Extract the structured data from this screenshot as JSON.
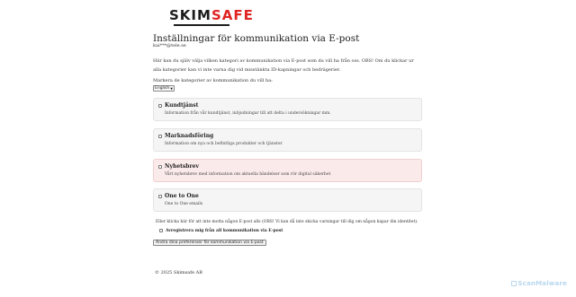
{
  "logo": {
    "part1": "SKIM",
    "part2": "SAFE"
  },
  "page": {
    "title": "Inställningar för kommunikation via E-post",
    "email": "kai***@tele.se",
    "intro": "Här kan du själv välja vilken kategori av kommunikation via E-post som du vill ha från oss. OBS! Om du klickar ur alla kategorier kan vi inte varna dig vid misstänkta ID-kapningar och bedrägerier.",
    "pick_label": "Markera de kategorier av kommunikation du vill ha:",
    "language": "English"
  },
  "categories": [
    {
      "name": "Kundtjänst",
      "desc": "Information från vår kundtjänst, inbjudningar till att delta i undersökningar mm.",
      "checked": false,
      "highlight": false
    },
    {
      "name": "Marknadsföring",
      "desc": "Information om nya och befintliga produkter och tjänster",
      "checked": false,
      "highlight": false
    },
    {
      "name": "Nyhetsbrev",
      "desc": "Vårt nyhetsbrev med information om aktuella händelser som rör digital säkerhet",
      "checked": false,
      "highlight": true
    },
    {
      "name": "One to One",
      "desc": "One to One emails",
      "checked": false,
      "highlight": false
    }
  ],
  "note": "Eller klicka här för att inte motta någon E-post alls (OBS! Vi kan då inte skicka varningar till dig om någon kapar din identitet).",
  "unsubscribe_label": "Avregistrera mig från all kommunikation via E-post",
  "submit_label": "Ändra dina preferenser för kommunikation via E-post",
  "footer": "© 2025 Skimsafe AB",
  "watermark": "ScanMalware",
  "colors": {
    "brand_red": "#e02424",
    "highlight_bg": "#fbeaea",
    "card_bg": "#f5f5f5"
  }
}
